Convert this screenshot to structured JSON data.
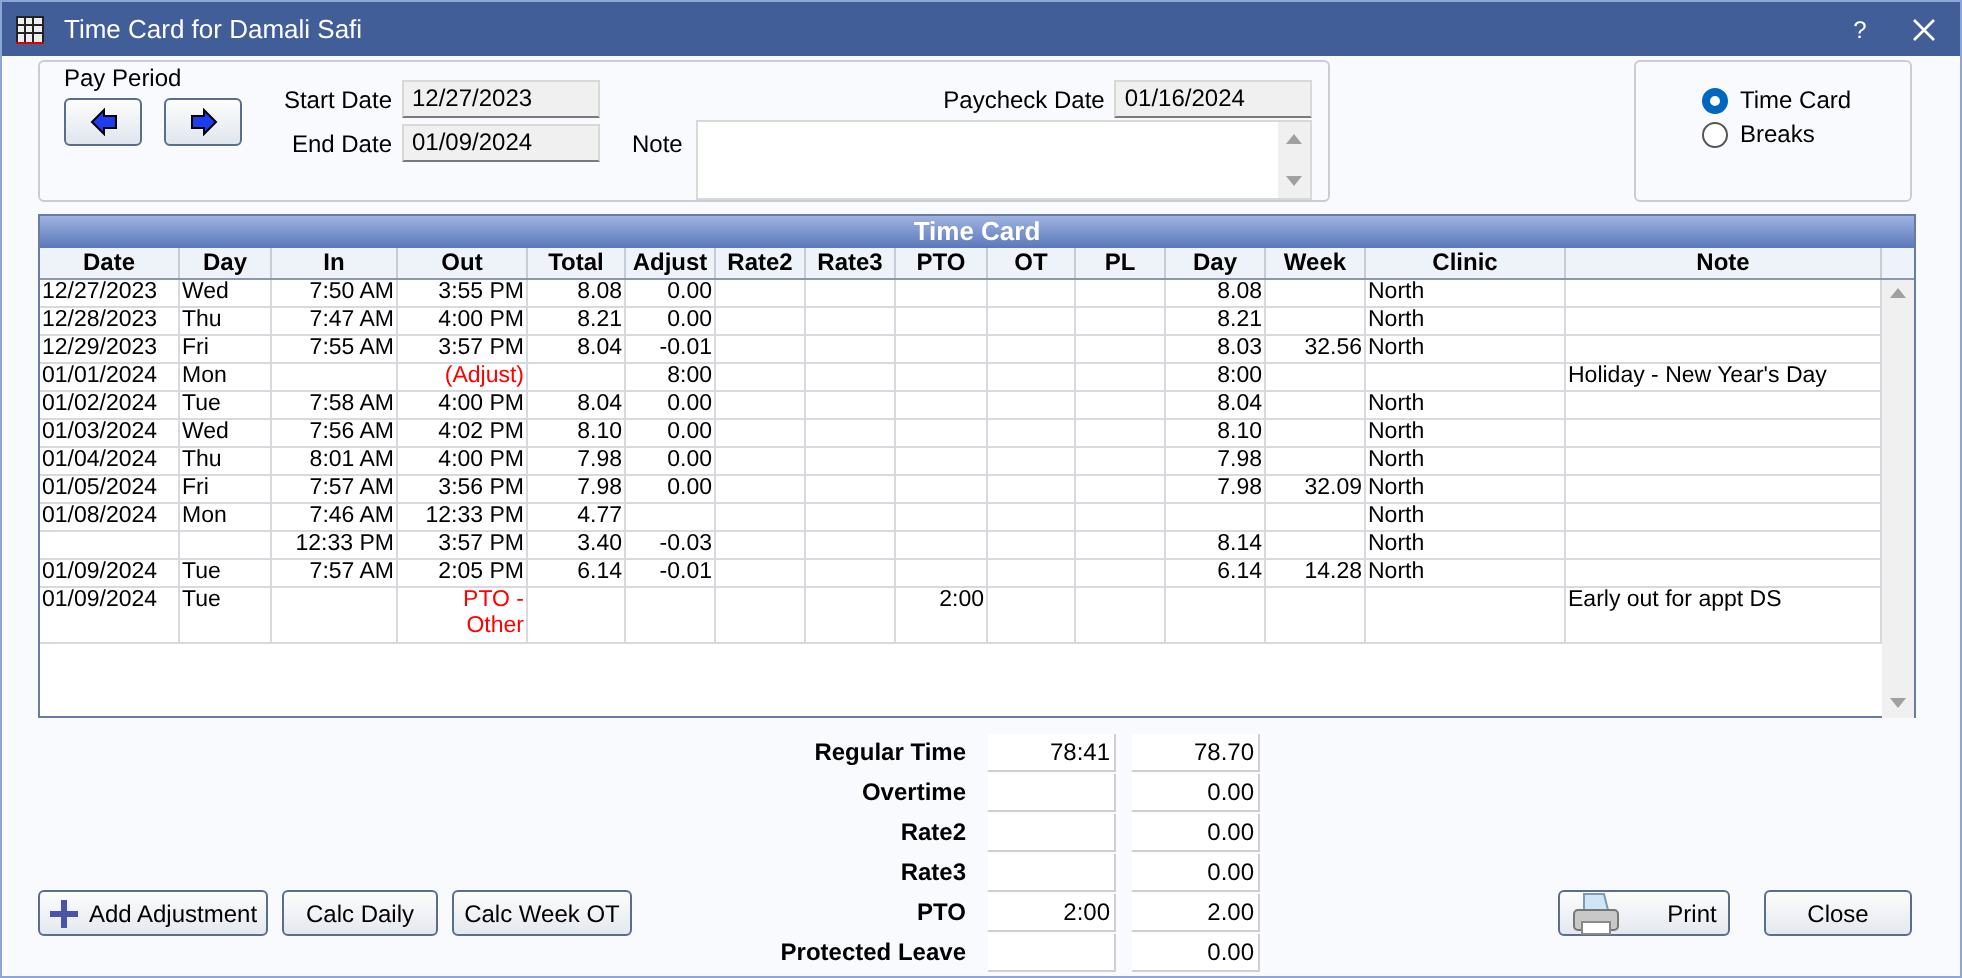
{
  "window": {
    "title": "Time Card for Damali Safi",
    "help": "?"
  },
  "pay_period": {
    "label": "Pay Period",
    "start_label": "Start Date",
    "start_date": "12/27/2023",
    "end_label": "End Date",
    "end_date": "01/09/2024",
    "paycheck_label": "Paycheck Date",
    "paycheck_date": "01/16/2024",
    "note_label": "Note"
  },
  "view_options": [
    {
      "label": "Time Card",
      "selected": true
    },
    {
      "label": "Breaks",
      "selected": false
    }
  ],
  "grid": {
    "title": "Time Card",
    "columns": [
      "Date",
      "Day",
      "In",
      "Out",
      "Total",
      "Adjust",
      "Rate2",
      "Rate3",
      "PTO",
      "OT",
      "PL",
      "Day",
      "Week",
      "Clinic",
      "Note"
    ],
    "rows": [
      {
        "kind": "punch",
        "date": "12/27/2023",
        "day": "Wed",
        "in": "7:50 AM",
        "out": "3:55 PM",
        "total": "8.08",
        "adjust": "0.00",
        "day_total": "8.08",
        "clinic": "North"
      },
      {
        "kind": "punch",
        "date": "12/28/2023",
        "day": "Thu",
        "in": "7:47 AM",
        "out": "4:00 PM",
        "total": "8.21",
        "adjust": "0.00",
        "day_total": "8.21",
        "clinic": "North"
      },
      {
        "kind": "punch",
        "date": "12/29/2023",
        "day": "Fri",
        "in": "7:55 AM",
        "out": "3:57 PM",
        "total": "8.04",
        "adjust": "-0.01",
        "day_total": "8.03",
        "week_total": "32.56",
        "clinic": "North"
      },
      {
        "kind": "adjustment",
        "date": "01/01/2024",
        "day": "Mon",
        "out": "(Adjust)",
        "adjust": "8:00",
        "day_total": "8:00",
        "note": "Holiday - New Year's Day"
      },
      {
        "kind": "punch",
        "date": "01/02/2024",
        "day": "Tue",
        "in": "7:58 AM",
        "out": "4:00 PM",
        "total": "8.04",
        "adjust": "0.00",
        "day_total": "8.04",
        "clinic": "North"
      },
      {
        "kind": "punch",
        "date": "01/03/2024",
        "day": "Wed",
        "in": "7:56 AM",
        "out": "4:02 PM",
        "total": "8.10",
        "adjust": "0.00",
        "day_total": "8.10",
        "clinic": "North"
      },
      {
        "kind": "punch",
        "date": "01/04/2024",
        "day": "Thu",
        "in": "8:01 AM",
        "out": "4:00 PM",
        "total": "7.98",
        "adjust": "0.00",
        "day_total": "7.98",
        "clinic": "North"
      },
      {
        "kind": "punch",
        "date": "01/05/2024",
        "day": "Fri",
        "in": "7:57 AM",
        "out": "3:56 PM",
        "total": "7.98",
        "adjust": "0.00",
        "day_total": "7.98",
        "week_total": "32.09",
        "clinic": "North"
      },
      {
        "kind": "punch",
        "date": "01/08/2024",
        "day": "Mon",
        "in": "7:46 AM",
        "out": "12:33 PM",
        "total": "4.77",
        "clinic": "North"
      },
      {
        "kind": "punch",
        "in": "12:33 PM",
        "out": "3:57 PM",
        "total": "3.40",
        "adjust": "-0.03",
        "day_total": "8.14",
        "clinic": "North"
      },
      {
        "kind": "punch",
        "date": "01/09/2024",
        "day": "Tue",
        "in": "7:57 AM",
        "out": "2:05 PM",
        "total": "6.14",
        "adjust": "-0.01",
        "day_total": "6.14",
        "week_total": "14.28",
        "clinic": "North"
      },
      {
        "kind": "pto",
        "date": "01/09/2024",
        "day": "Tue",
        "out": "PTO - Other",
        "pto": "2:00",
        "note": "Early out for appt DS"
      }
    ]
  },
  "totals": [
    {
      "label": "Regular Time",
      "hours": "78:41",
      "decimal": "78.70"
    },
    {
      "label": "Overtime",
      "decimal": "0.00"
    },
    {
      "label": "Rate2",
      "decimal": "0.00"
    },
    {
      "label": "Rate3",
      "decimal": "0.00"
    },
    {
      "label": "PTO",
      "hours": "2:00",
      "decimal": "2.00"
    },
    {
      "label": "Protected Leave",
      "decimal": "0.00"
    }
  ],
  "buttons_left": [
    {
      "label": "Add Adjustment",
      "kind": "add"
    },
    {
      "label": "Calc Daily",
      "kind": "plain"
    },
    {
      "label": "Calc Week OT",
      "kind": "plain"
    }
  ],
  "buttons_right": [
    {
      "label": "Print",
      "kind": "print"
    },
    {
      "label": "Close",
      "kind": "plain"
    }
  ]
}
